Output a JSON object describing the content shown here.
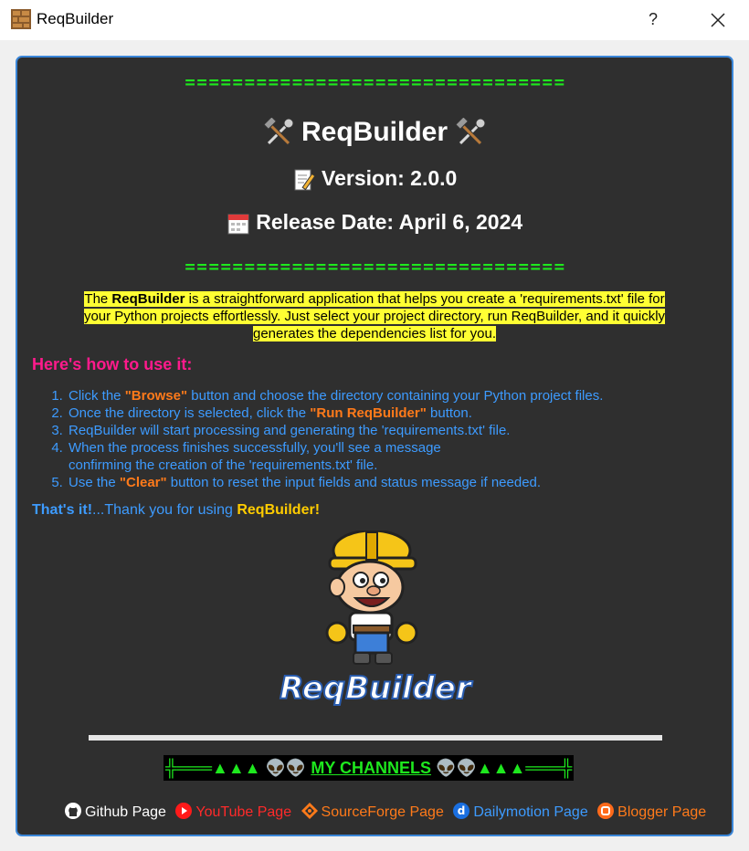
{
  "window": {
    "title": "ReqBuilder",
    "help_label": "?",
    "close_icon": "close-icon"
  },
  "header": {
    "separator": "================================",
    "app_name": "ReqBuilder",
    "version": "Version: 2.0.0",
    "release_date": "Release Date: April 6, 2024",
    "title_icon": "hammer-and-wrench-icon",
    "version_icon": "memo-icon",
    "date_icon": "calendar-icon"
  },
  "intro": {
    "pre": "The ",
    "app_name": "ReqBuilder",
    "post": " is a straightforward application that helps you create a 'requirements.txt' file for your Python projects effortlessly. Just select your project directory, run ReqBuilder, and it quickly generates the dependencies list for you."
  },
  "howto": {
    "title": "Here's how to use it:",
    "steps": [
      {
        "pre": "Click the ",
        "bold": "\"Browse\"",
        "post": " button and choose the directory containing your Python project files."
      },
      {
        "pre": "Once the directory is selected, click the ",
        "bold": "\"Run ReqBuilder\"",
        "post": " button."
      },
      {
        "pre": "ReqBuilder will start processing and generating the 'requirements.txt' file.",
        "bold": "",
        "post": ""
      },
      {
        "pre": "When the process finishes successfully, you'll see a message",
        "line2": "confirming the creation of the 'requirements.txt' file."
      },
      {
        "pre": "Use the ",
        "bold": "\"Clear\"",
        "post": " button to reset the input fields and status message if needed."
      }
    ]
  },
  "thanks": {
    "lead": "That's it!",
    "middle": "...Thank you for using ",
    "app": "ReqBuilder!"
  },
  "logo": {
    "text": "ReqBuilder"
  },
  "channels": {
    "left_deco": "╬═══▲▲▲",
    "right_deco": "▲▲▲═══╬",
    "label": "MY CHANNELS",
    "icon": "alien-icon"
  },
  "links": [
    {
      "label": "Github Page",
      "color": "#ffffff",
      "icon": "github-icon"
    },
    {
      "label": "YouTube Page",
      "color": "#ff2a2a",
      "icon": "youtube-icon"
    },
    {
      "label": "SourceForge Page",
      "color": "#ff7a1a",
      "icon": "sourceforge-icon"
    },
    {
      "label": "Dailymotion Page",
      "color": "#3d9bff",
      "icon": "dailymotion-icon"
    },
    {
      "label": "Blogger Page",
      "color": "#ff7a1a",
      "icon": "blogger-icon"
    }
  ],
  "colors": {
    "panel_bg": "#2f2f2f",
    "panel_border": "#3a86d8",
    "separator_green": "#1ee81e",
    "highlight_yellow": "#ffff33",
    "howto_pink": "#ff1a8c",
    "step_blue": "#3d9bff",
    "accent_orange": "#ff7a1a"
  }
}
